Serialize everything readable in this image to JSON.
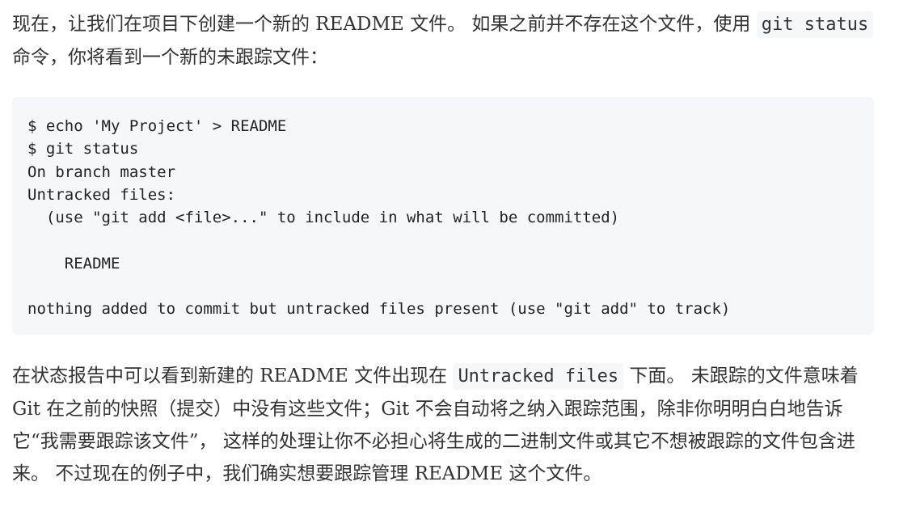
{
  "intro": {
    "text_before": "现在，让我们在项目下创建一个新的 README 文件。 如果之前并不存在这个文件，使用 ",
    "code": "git status",
    "text_after": " 命令，你将看到一个新的未跟踪文件："
  },
  "code_block": {
    "lines": [
      "$ echo 'My Project' > README",
      "$ git status",
      "On branch master",
      "Untracked files:",
      "  (use \"git add <file>...\" to include in what will be committed)",
      "",
      "    README",
      "",
      "nothing added to commit but untracked files present (use \"git add\" to track)"
    ]
  },
  "explanation": {
    "text_before": "在状态报告中可以看到新建的 README 文件出现在 ",
    "code": "Untracked files",
    "text_after": " 下面。 未跟踪的文件意味着 Git 在之前的快照（提交）中没有这些文件；Git 不会自动将之纳入跟踪范围，除非你明明白白地告诉它“我需要跟踪该文件”， 这样的处理让你不必担心将生成的二进制文件或其它不想被跟踪的文件包含进来。 不过现在的例子中，我们确实想要跟踪管理 README 这个文件。"
  }
}
